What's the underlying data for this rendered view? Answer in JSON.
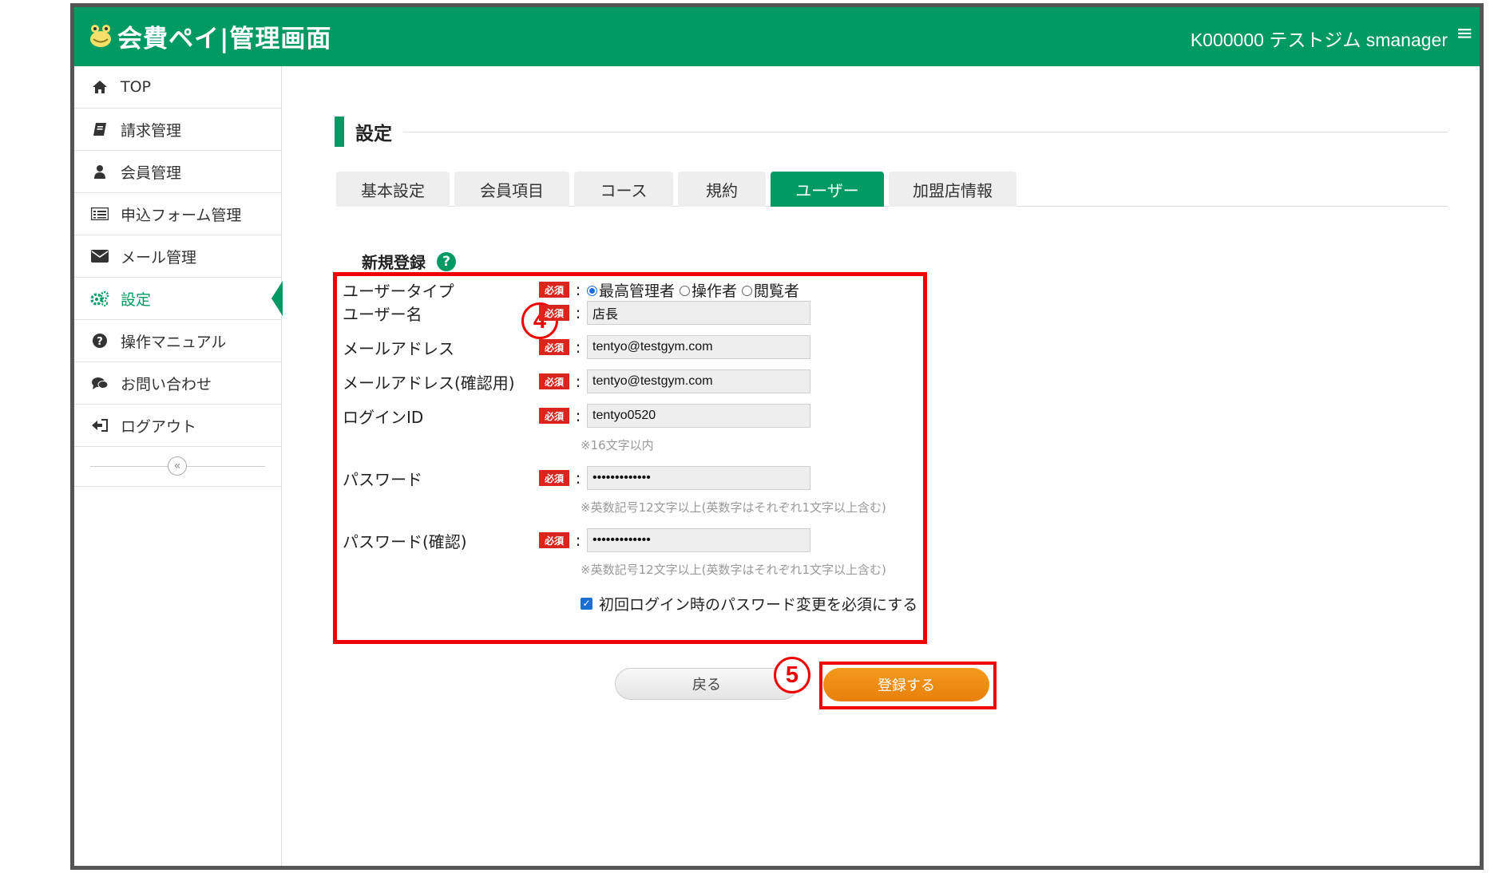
{
  "header": {
    "brand": "会費ペイ|管理画面",
    "account": "K000000 テストジム smanager",
    "menu_icon": "hamburger-icon",
    "color": "#009a62"
  },
  "sidebar": {
    "items": [
      {
        "label": "TOP",
        "icon": "home-icon"
      },
      {
        "label": "請求管理",
        "icon": "book-icon"
      },
      {
        "label": "会員管理",
        "icon": "user-icon"
      },
      {
        "label": "申込フォーム管理",
        "icon": "list-icon"
      },
      {
        "label": "メール管理",
        "icon": "envelope-icon"
      },
      {
        "label": "設定",
        "icon": "gears-icon",
        "active": true
      },
      {
        "label": "操作マニュアル",
        "icon": "question-icon"
      },
      {
        "label": "お問い合わせ",
        "icon": "chat-icon"
      },
      {
        "label": "ログアウト",
        "icon": "logout-icon"
      }
    ],
    "collapse": "«"
  },
  "main": {
    "title": "設定",
    "tabs": [
      {
        "label": "基本設定"
      },
      {
        "label": "会員項目"
      },
      {
        "label": "コース"
      },
      {
        "label": "規約"
      },
      {
        "label": "ユーザー",
        "active": true
      },
      {
        "label": "加盟店情報"
      }
    ],
    "section_title": "新規登録",
    "help": "?"
  },
  "form": {
    "required": "必須",
    "colon": ":",
    "user_type": {
      "label": "ユーザータイプ",
      "options": [
        "最高管理者",
        "操作者",
        "閲覧者"
      ],
      "selected": "最高管理者"
    },
    "user_name": {
      "label": "ユーザー名",
      "value": "店長"
    },
    "email": {
      "label": "メールアドレス",
      "value": "tentyo@testgym.com"
    },
    "email_confirm": {
      "label": "メールアドレス(確認用)",
      "value": "tentyo@testgym.com"
    },
    "login_id": {
      "label": "ログインID",
      "value": "tentyo0520",
      "hint": "※16文字以内"
    },
    "password": {
      "label": "パスワード",
      "value": "•••••••••••••",
      "hint": "※英数記号12文字以上(英数字はそれぞれ1文字以上含む)"
    },
    "password_confirm": {
      "label": "パスワード(確認)",
      "value": "•••••••••••••",
      "hint": "※英数記号12文字以上(英数字はそれぞれ1文字以上含む)"
    },
    "force_change": {
      "label": "初回ログイン時のパスワード変更を必須にする",
      "checked": true
    }
  },
  "buttons": {
    "back": "戻る",
    "submit": "登録する"
  },
  "annotations": {
    "step4": "4",
    "step5": "5"
  }
}
